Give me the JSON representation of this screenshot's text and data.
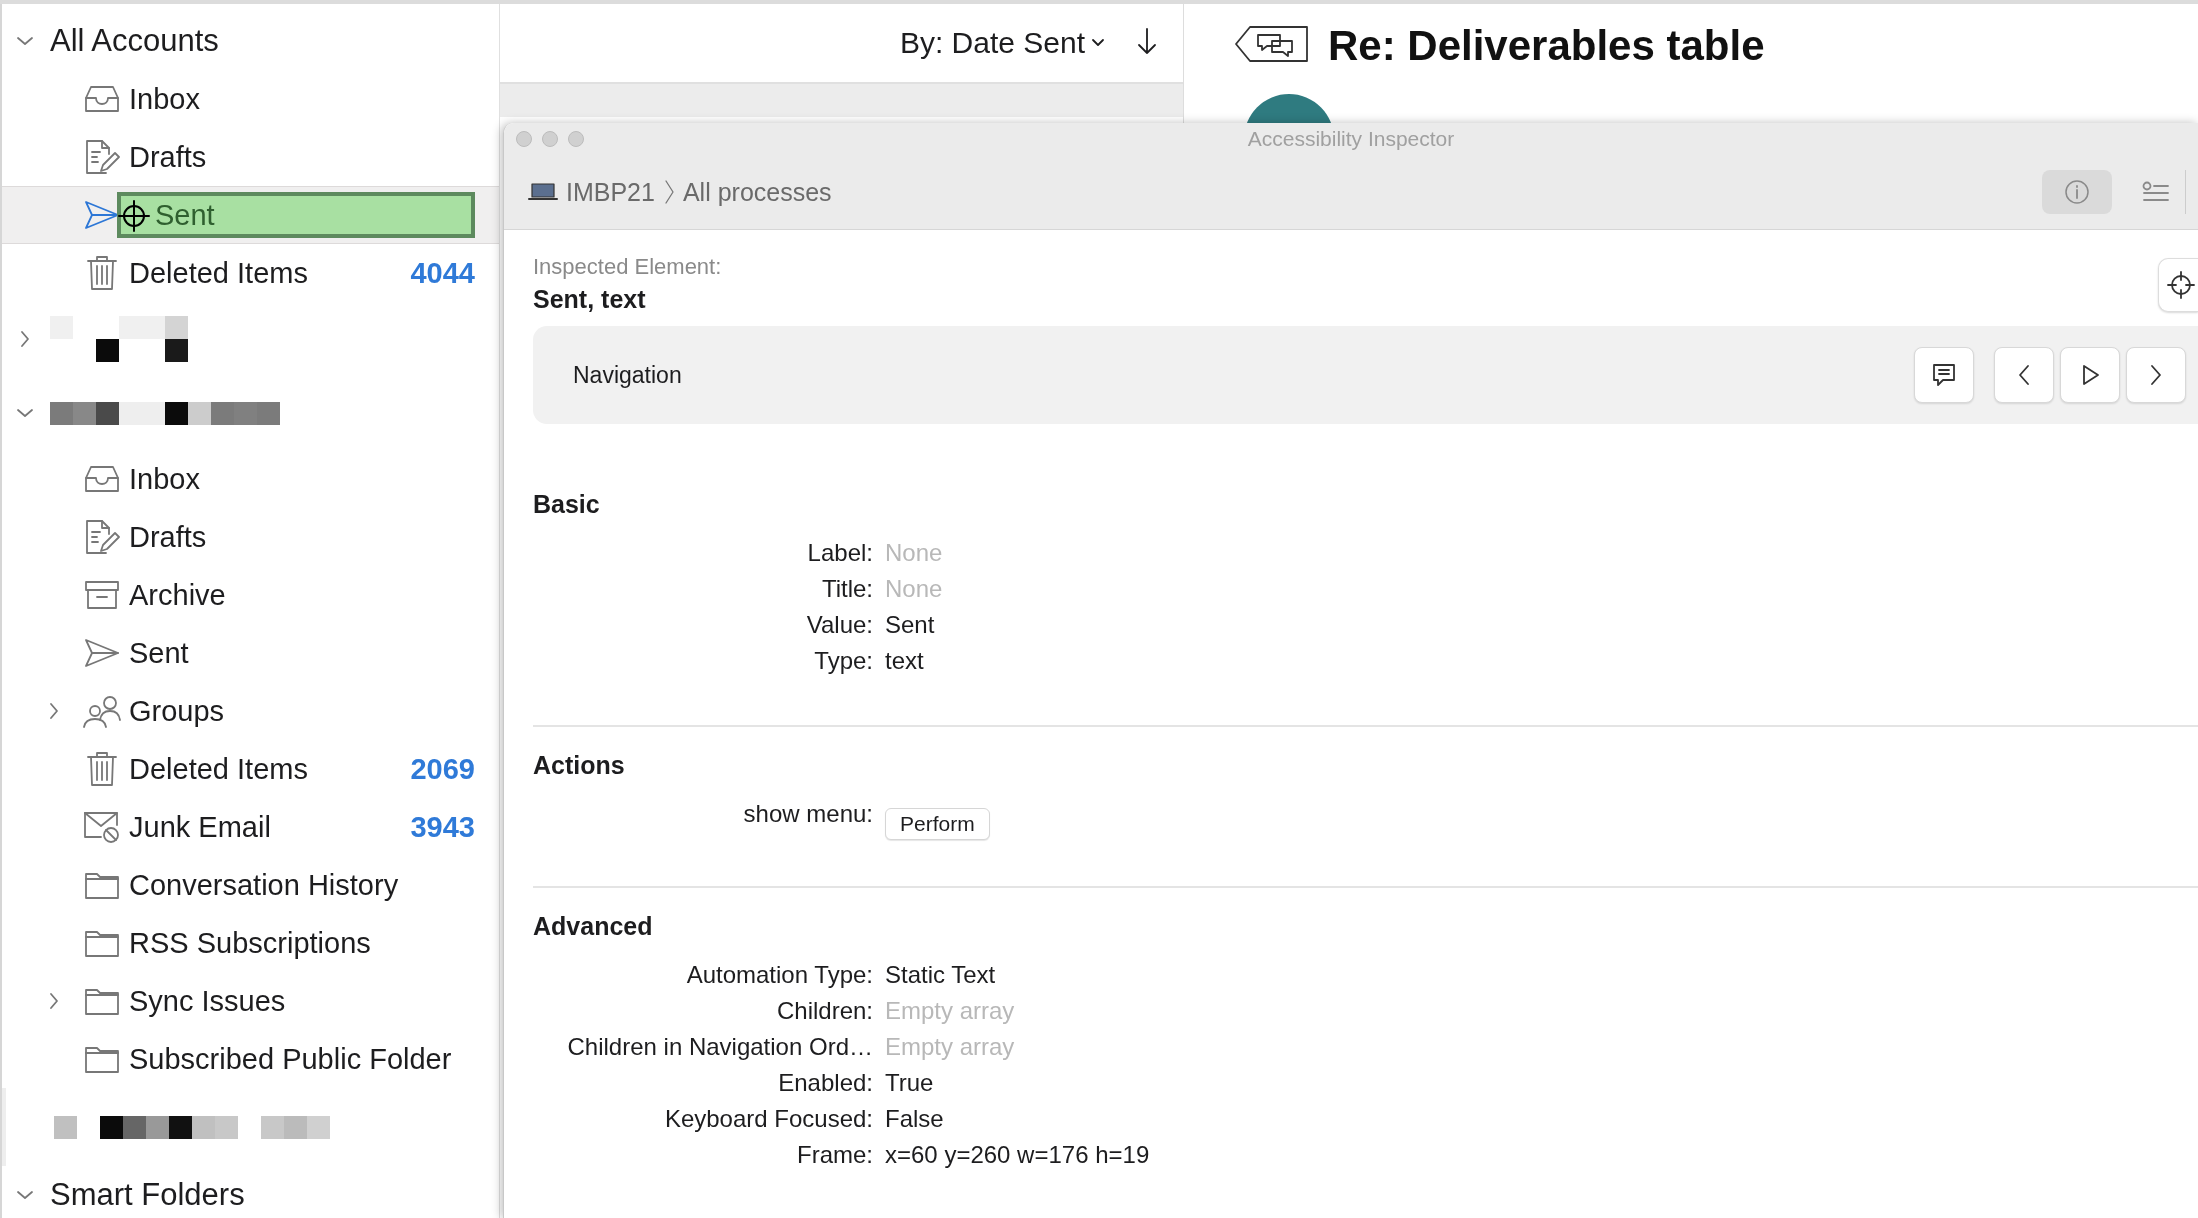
{
  "sidebar": {
    "accounts": [
      {
        "kind": "named",
        "name": "All Accounts",
        "expanded": true,
        "folders": [
          {
            "name": "Inbox",
            "kind": "inbox",
            "selected": false,
            "inspected": false
          },
          {
            "name": "Drafts",
            "kind": "drafts",
            "selected": false,
            "inspected": false
          },
          {
            "name": "Sent",
            "kind": "sent",
            "selected": true,
            "inspected": true
          },
          {
            "name": "Deleted Items",
            "kind": "trash",
            "count": "4044",
            "selected": false,
            "inspected": false
          }
        ]
      },
      {
        "kind": "redacted",
        "expanded": false
      },
      {
        "kind": "redacted",
        "expanded": true,
        "folders": [
          {
            "name": "Inbox",
            "kind": "inbox",
            "selected": false,
            "inspected": false
          },
          {
            "name": "Drafts",
            "kind": "drafts",
            "selected": false,
            "inspected": false
          },
          {
            "name": "Archive",
            "kind": "archive",
            "selected": false,
            "inspected": false
          },
          {
            "name": "Sent",
            "kind": "sent",
            "selected": false,
            "inspected": false
          },
          {
            "name": "Groups",
            "kind": "groups",
            "expanded": false,
            "selected": false,
            "inspected": false
          },
          {
            "name": "Deleted Items",
            "kind": "trash",
            "count": "2069",
            "selected": false,
            "inspected": false
          },
          {
            "name": "Junk Email",
            "kind": "junk",
            "count": "3943",
            "selected": false,
            "inspected": false
          },
          {
            "name": "Conversation History",
            "kind": "folder",
            "selected": false,
            "inspected": false
          },
          {
            "name": "RSS Subscriptions",
            "kind": "folder",
            "selected": false,
            "inspected": false
          },
          {
            "name": "Sync Issues",
            "kind": "folder",
            "expanded": false,
            "selected": false,
            "inspected": false
          },
          {
            "name": "Subscribed Public Folder",
            "kind": "folder",
            "selected": false,
            "inspected": false
          }
        ]
      },
      {
        "kind": "redacted-plain"
      },
      {
        "kind": "named",
        "name": "Smart Folders",
        "expanded": true
      }
    ]
  },
  "message_list": {
    "sort": "By: Date Sent"
  },
  "reading_pane": {
    "subject": "Re: Deliverables table"
  },
  "inspector": {
    "title": "Accessibility Inspector",
    "breadcrumb": [
      "IMBP21",
      "All processes"
    ],
    "toolbar": [
      {
        "kind": "info",
        "selected": true
      },
      {
        "kind": "list",
        "selected": false
      }
    ],
    "inspected_label": "Inspected Element:",
    "inspected_value": "Sent, text",
    "navigation": {
      "label": "Navigation",
      "buttons": [
        {
          "kind": "speak"
        },
        {
          "kind": "previous"
        },
        {
          "kind": "activate"
        },
        {
          "kind": "next"
        }
      ]
    },
    "sections": [
      {
        "title": "Basic",
        "rows": [
          {
            "label": "Label:",
            "value": "None",
            "kind": "text",
            "empty": true
          },
          {
            "label": "Title:",
            "value": "None",
            "kind": "text",
            "empty": true
          },
          {
            "label": "Value:",
            "value": "Sent",
            "kind": "text",
            "empty": false
          },
          {
            "label": "Type:",
            "value": "text",
            "kind": "text",
            "empty": false
          }
        ]
      },
      {
        "title": "Actions",
        "rows": [
          {
            "label": "show menu:",
            "value": "Perform",
            "kind": "button"
          }
        ]
      },
      {
        "title": "Advanced",
        "rows": [
          {
            "label": "Automation Type:",
            "value": "Static Text",
            "kind": "text",
            "empty": false
          },
          {
            "label": "Children:",
            "value": "Empty array",
            "kind": "text",
            "empty": true
          },
          {
            "label": "Children in Navigation Ord…",
            "value": "Empty array",
            "kind": "text",
            "empty": true
          },
          {
            "label": "Enabled:",
            "value": "True",
            "kind": "text",
            "empty": false
          },
          {
            "label": "Keyboard Focused:",
            "value": "False",
            "kind": "text",
            "empty": false
          },
          {
            "label": "Frame:",
            "value": "x=60 y=260 w=176 h=19",
            "kind": "text",
            "empty": false
          }
        ]
      }
    ]
  }
}
